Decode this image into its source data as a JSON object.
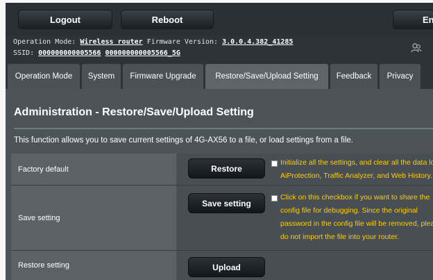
{
  "header": {
    "logout_label": "Logout",
    "reboot_label": "Reboot",
    "language_label": "En"
  },
  "info": {
    "operation_mode_label": "Operation Mode:",
    "operation_mode_value": "Wireless router",
    "firmware_label": "Firmware Version:",
    "firmware_value": "3.0.0.4.382_41285",
    "ssid_label": "SSID:",
    "ssid_1": "000000000005566",
    "ssid_2": "000000000005566_5G"
  },
  "tabs": [
    {
      "label": "Operation Mode"
    },
    {
      "label": "System"
    },
    {
      "label": "Firmware Upgrade"
    },
    {
      "label": "Restore/Save/Upload Setting"
    },
    {
      "label": "Feedback"
    },
    {
      "label": "Privacy"
    }
  ],
  "main": {
    "title": "Administration - Restore/Save/Upload Setting",
    "description": "This function allows you to save current settings of 4G-AX56 to a file, or load settings from a file.",
    "rows": [
      {
        "label": "Factory default",
        "button": "Restore",
        "note_lines": [
          "Initialize all the settings, and clear all the data lo",
          "AiProtection, Traffic Analyzer, and Web History."
        ]
      },
      {
        "label": "Save setting",
        "button": "Save setting",
        "note_lines": [
          "Click on this checkbox if you want to share the",
          "config file for debugging. Since the original",
          "password in the config file will be removed, plea",
          "do not import the file into your router."
        ]
      },
      {
        "label": "Restore setting",
        "button": "Upload"
      }
    ]
  },
  "colors": {
    "accent_note": "#ffcc00",
    "status_online": "#4fc64f"
  },
  "icons": [
    "user-icon",
    "status-dot-icon"
  ]
}
